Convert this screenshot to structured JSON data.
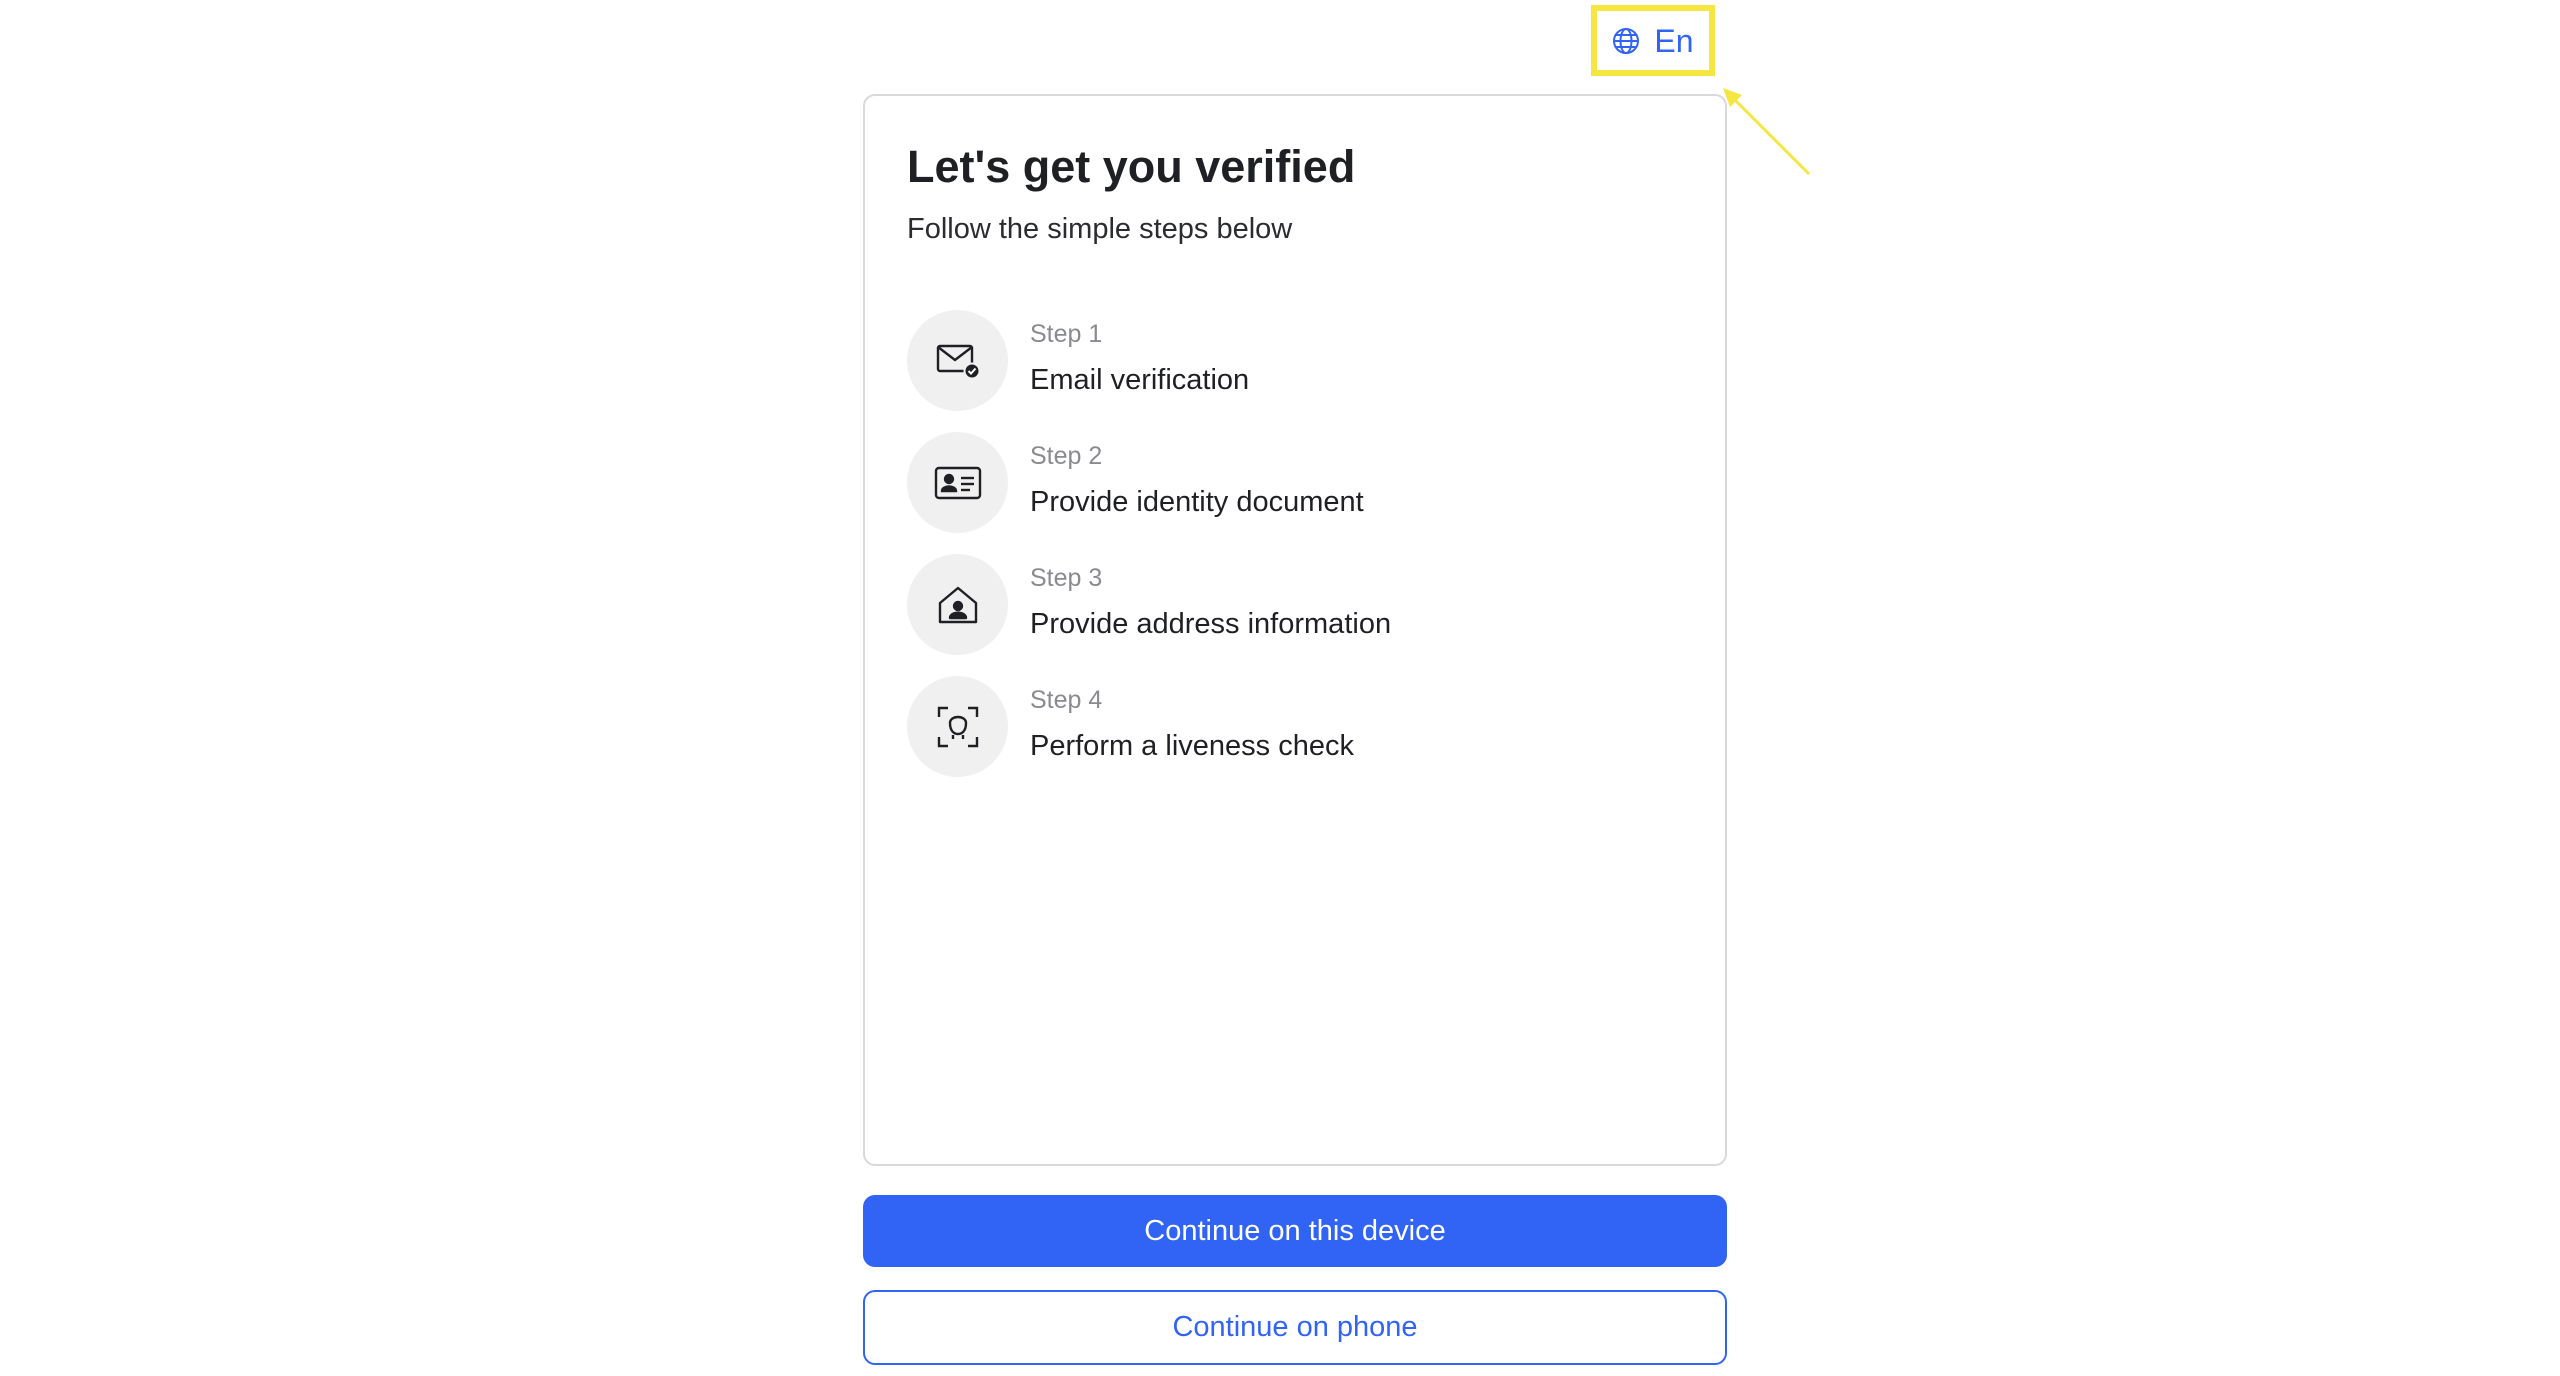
{
  "language": {
    "label": "En",
    "icon": "globe-icon"
  },
  "card": {
    "title": "Let's get you verified",
    "subtitle": "Follow the simple steps below",
    "steps": [
      {
        "number": "Step 1",
        "label": "Email verification",
        "icon": "email-check-icon"
      },
      {
        "number": "Step 2",
        "label": "Provide identity document",
        "icon": "id-card-icon"
      },
      {
        "number": "Step 3",
        "label": "Provide address information",
        "icon": "home-person-icon"
      },
      {
        "number": "Step 4",
        "label": "Perform a liveness check",
        "icon": "face-scan-icon"
      }
    ]
  },
  "actions": {
    "primary_label": "Continue on this device",
    "secondary_label": "Continue on phone"
  },
  "colors": {
    "accent": "#3164f5",
    "highlight": "#f5e642",
    "icon_bg": "#f0f0f1"
  }
}
